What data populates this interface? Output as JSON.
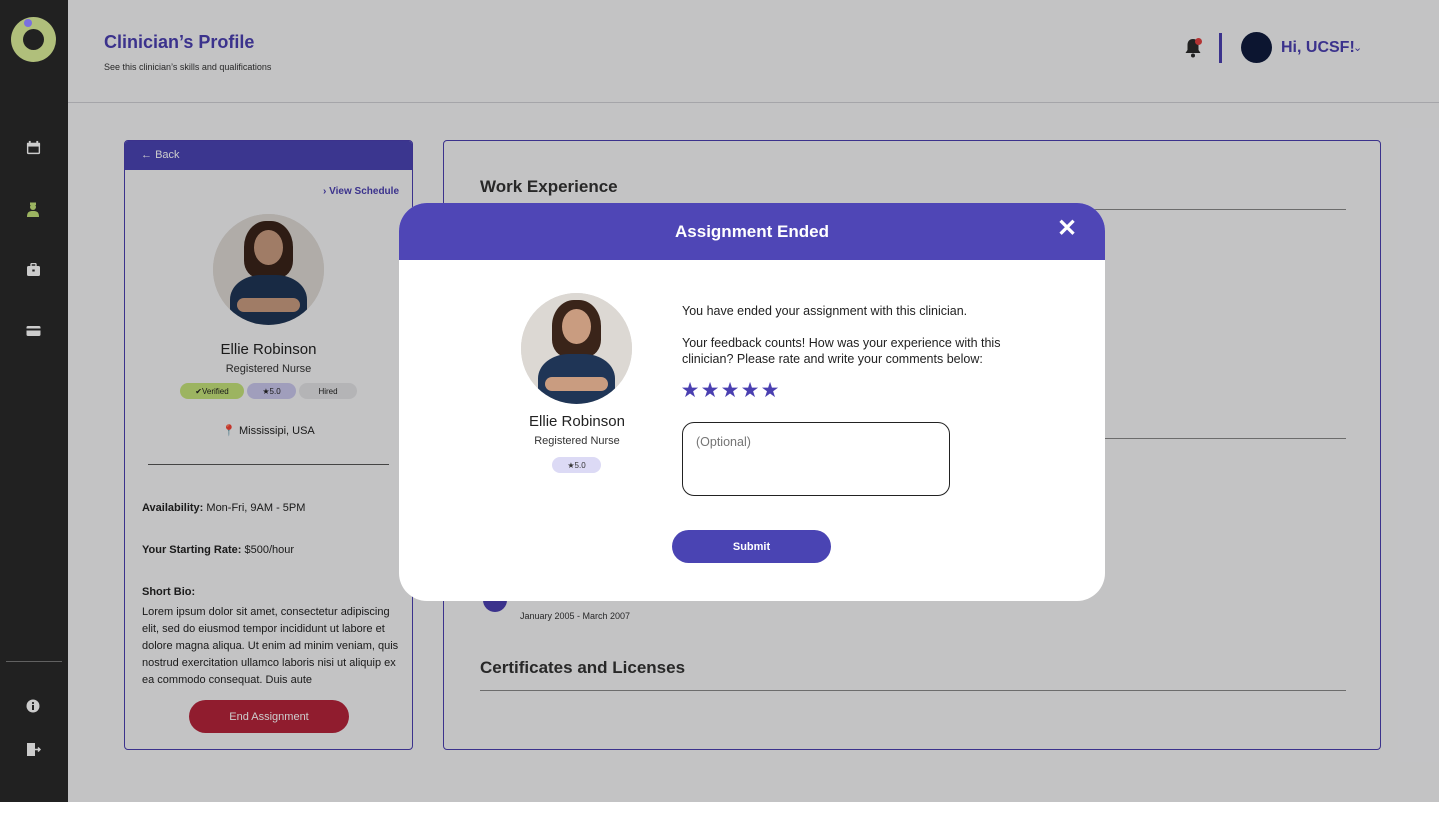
{
  "header": {
    "title": "Clinician’s Profile",
    "subtitle": "See this clinician’s skills and qualifications",
    "greeting": "Hi, UCSF!"
  },
  "sidebar": {
    "items": [
      {
        "icon": "calendar-icon"
      },
      {
        "icon": "nurse-icon"
      },
      {
        "icon": "briefcase-icon"
      },
      {
        "icon": "credit-card-icon"
      },
      {
        "icon": "info-icon"
      },
      {
        "icon": "logout-icon"
      }
    ]
  },
  "left_card": {
    "back_label": "Back",
    "view_schedule_label": "View Schedule",
    "name": "Ellie Robinson",
    "role": "Registered Nurse",
    "badges": {
      "verified": "Verified",
      "rating": "5.0",
      "hired": "Hired"
    },
    "location": "Mississipi, USA",
    "availability_label": "Availability:",
    "availability_value": "Mon-Fri, 9AM - 5PM",
    "rate_label": "Your Starting Rate:",
    "rate_value": "$500/hour",
    "bio_label": "Short Bio:",
    "bio_text": "Lorem ipsum dolor sit amet, consectetur adipiscing elit, sed do eiusmod tempor incididunt ut labore et dolore magna aliqua. Ut enim ad minim veniam, quis nostrud exercitation ullamco laboris nisi ut aliquip ex ea commodo consequat. Duis aute",
    "end_button": "End Assignment"
  },
  "right_card": {
    "work_experience_heading": "Work Experience",
    "entry_date": "January 2005 - March 2007",
    "certificates_heading": "Certificates and Licenses"
  },
  "modal": {
    "title": "Assignment Ended",
    "name": "Ellie Robinson",
    "role": "Registered Nurse",
    "rating": "5.0",
    "message": "You have ended your assignment with this clinician.",
    "prompt": "Your feedback counts! How was your experience with this clinician? Please rate and write your comments below:",
    "stars_selected": 5,
    "stars_total": 5,
    "comment_placeholder": "(Optional)",
    "submit_label": "Submit"
  },
  "colors": {
    "brand": "#4a3fb0",
    "end_button": "#b5233a",
    "verified_badge": "#c4e27a",
    "sidebar": "#2a2a2a"
  }
}
